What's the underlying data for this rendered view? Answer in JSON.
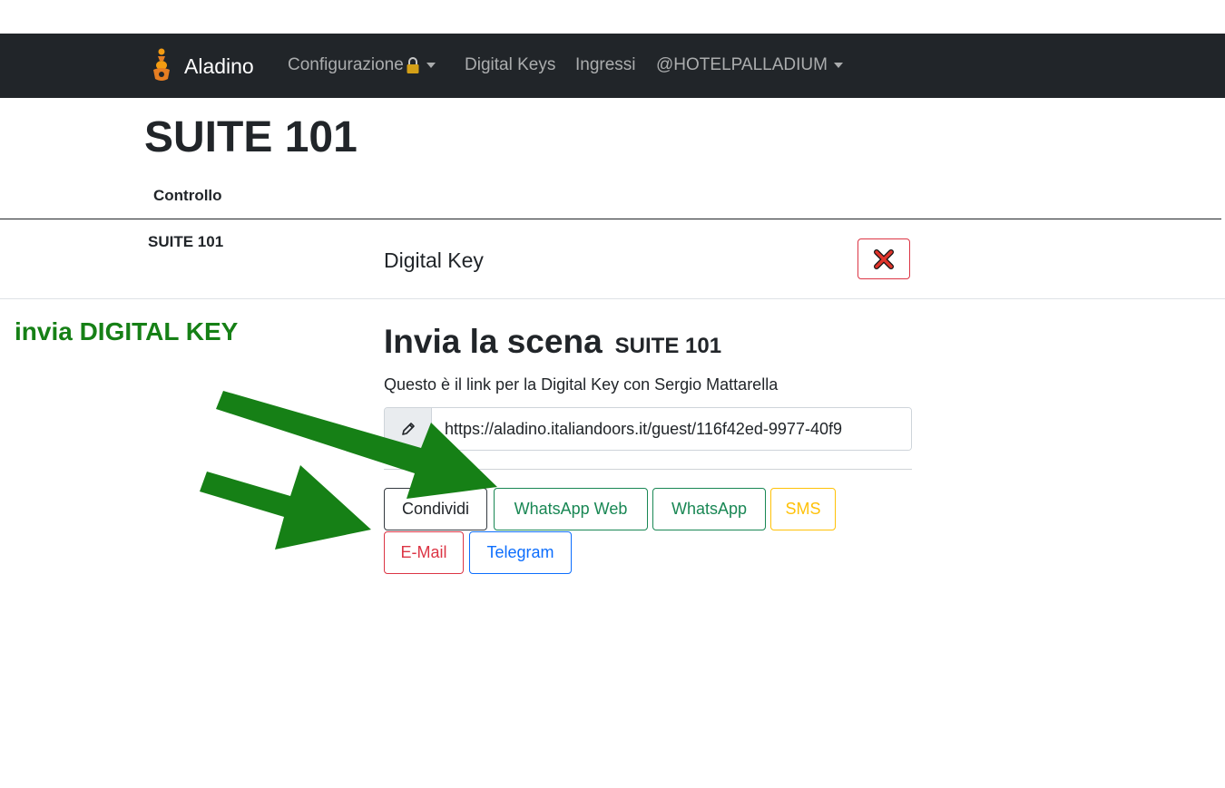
{
  "navbar": {
    "brand": "Aladino",
    "menu_configurazione": "Configurazione",
    "menu_digital_keys": "Digital Keys",
    "menu_ingressi": "Ingressi",
    "menu_account": "@HOTELPALLADIUM"
  },
  "page": {
    "title": "SUITE 101",
    "table_header": "Controllo",
    "row_label": "SUITE 101"
  },
  "annotation": {
    "text": "invia DIGITAL KEY",
    "color": "#168016"
  },
  "modal": {
    "title": "Digital Key",
    "heading": "Invia la scena",
    "scene_name": "SUITE 101",
    "description": "Questo è il link per la Digital Key con Sergio Mattarella",
    "link_value": "https://aladino.italiandoors.it/guest/116f42ed-9977-40f9",
    "buttons": {
      "condividi": "Condividi",
      "whatsapp_web": "WhatsApp Web",
      "whatsapp": "WhatsApp",
      "sms": "SMS",
      "email": "E-Mail",
      "telegram": "Telegram"
    }
  },
  "icons": {
    "brand": "aladino-lamp-icon",
    "lock": "padlock-icon",
    "close": "close-x-icon",
    "edit": "pencil-icon"
  },
  "colors": {
    "navbar_bg": "#212529",
    "success": "#198754",
    "warning": "#ffc107",
    "danger": "#dc3545",
    "primary": "#0d6efd",
    "arrow": "#168016"
  }
}
